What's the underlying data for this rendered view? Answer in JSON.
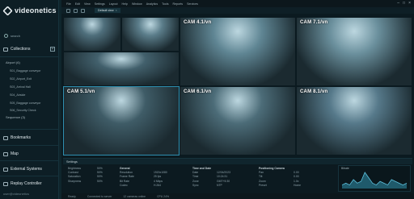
{
  "brand": {
    "name": "videonetics"
  },
  "sidebar": {
    "search_placeholder": "search",
    "collections_label": "Collections",
    "airport_label": "Airport (6)",
    "cameras": [
      "S01_Baggage conveyor",
      "S02_Airport_Exit",
      "S03_Arrival Hall",
      "S04_Airside",
      "S05_Baggage conveyor",
      "S06_Security Check"
    ],
    "sequences_label": "Sequence (3)",
    "bookmarks_label": "Bookmarks",
    "map_label": "Map",
    "external_label": "External Systems",
    "replay_label": "Replay Controller",
    "user_text": "user@videonetics"
  },
  "menubar": {
    "items": [
      "File",
      "Edit",
      "View",
      "Settings",
      "Layout",
      "Help",
      "Window",
      "Analytics",
      "Tools",
      "Reports",
      "Services"
    ]
  },
  "toolbar": {
    "tab_label": "Default view"
  },
  "cells": [
    {
      "label": ""
    },
    {
      "label": ""
    },
    {
      "label": ""
    },
    {
      "label": "CAM 4.1/vn"
    },
    {
      "label": "CAM 7.1/vn"
    },
    {
      "label": "CAM 5.1/vn"
    },
    {
      "label": "CAM 6.1/vn"
    },
    {
      "label": "CAM 8.1/vn"
    }
  ],
  "bottom": {
    "header": "Settings",
    "col1": [
      "Brightness",
      "Contrast",
      "Saturation",
      "Sharpness"
    ],
    "col1_vals": [
      "50%",
      "50%",
      "50%",
      "50%"
    ],
    "col2_title": "General",
    "col2": [
      "Resolution",
      "Frame Rate",
      "Bit Rate",
      "Codec"
    ],
    "col2_vals": [
      "1920x1080",
      "25 fps",
      "4 Mbps",
      "H.264"
    ],
    "col3_title": "Time and Date",
    "col3": [
      "Date",
      "Time",
      "Zone",
      "Sync"
    ],
    "col3_vals": [
      "12/04/2023",
      "10:24:31",
      "GMT+5:30",
      "NTP"
    ],
    "col4_title": "Positioning Camera",
    "col4": [
      "Pan",
      "Tilt",
      "Zoom",
      "Preset"
    ],
    "col4_vals": [
      "0.00",
      "0.00",
      "1.0x",
      "Home"
    ],
    "chart_title": "Bitrate",
    "chart_values": [
      2,
      3,
      2,
      5,
      3,
      4,
      9,
      6,
      3,
      2,
      4,
      3,
      2,
      5,
      4,
      3,
      2,
      3
    ]
  },
  "statusbar": {
    "items": [
      "Ready",
      "Connected to server",
      "12 cameras online",
      "CPU 24%"
    ]
  }
}
